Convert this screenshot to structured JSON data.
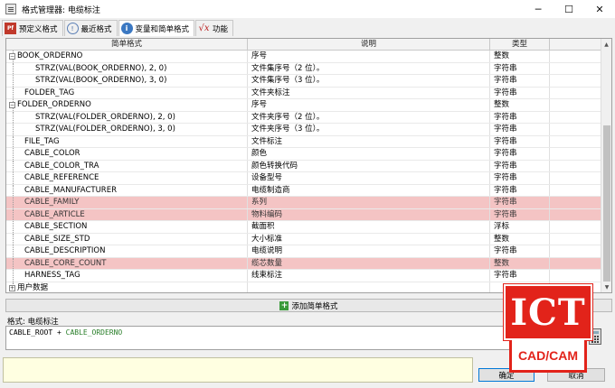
{
  "window": {
    "title": "格式管理器: 电缆标注",
    "min": "─",
    "max": "☐",
    "close": "✕"
  },
  "tabs": [
    {
      "label": "预定义格式",
      "icon": "preset-format-icon",
      "glyph": "Pf"
    },
    {
      "label": "最近格式",
      "icon": "clock-icon",
      "glyph": "!"
    },
    {
      "label": "变量和简单格式",
      "icon": "info-icon",
      "glyph": "i"
    },
    {
      "label": "功能",
      "icon": "function-icon",
      "glyph": "√x"
    }
  ],
  "grid": {
    "headers": {
      "name": "简单格式",
      "desc": "说明",
      "type": "类型"
    },
    "rows": [
      {
        "name": "BOOK_ORDERNO",
        "desc": "序号",
        "type": "整数",
        "indent": 0,
        "expander": "−"
      },
      {
        "name": "STRZ(VAL(BOOK_ORDERNO), 2, 0)",
        "desc": "文件集序号（2 位）。",
        "type": "字符串",
        "indent": 2
      },
      {
        "name": "STRZ(VAL(BOOK_ORDERNO), 3, 0)",
        "desc": "文件集序号（3 位）。",
        "type": "字符串",
        "indent": 2
      },
      {
        "name": "FOLDER_TAG",
        "desc": "文件夹标注",
        "type": "字符串",
        "indent": 1
      },
      {
        "name": "FOLDER_ORDERNO",
        "desc": "序号",
        "type": "整数",
        "indent": 0,
        "expander": "−"
      },
      {
        "name": "STRZ(VAL(FOLDER_ORDERNO), 2, 0)",
        "desc": "文件夹序号（2 位）。",
        "type": "字符串",
        "indent": 2
      },
      {
        "name": "STRZ(VAL(FOLDER_ORDERNO), 3, 0)",
        "desc": "文件夹序号（3 位）。",
        "type": "字符串",
        "indent": 2
      },
      {
        "name": "FILE_TAG",
        "desc": "文件标注",
        "type": "字符串",
        "indent": 1
      },
      {
        "name": "CABLE_COLOR",
        "desc": "颜色",
        "type": "字符串",
        "indent": 1
      },
      {
        "name": "CABLE_COLOR_TRA",
        "desc": "颜色转换代码",
        "type": "字符串",
        "indent": 1
      },
      {
        "name": "CABLE_REFERENCE",
        "desc": "设备型号",
        "type": "字符串",
        "indent": 1
      },
      {
        "name": "CABLE_MANUFACTURER",
        "desc": "电缆制造商",
        "type": "字符串",
        "indent": 1
      },
      {
        "name": "CABLE_FAMILY",
        "desc": "系列",
        "type": "字符串",
        "indent": 1,
        "highlight": true
      },
      {
        "name": "CABLE_ARTICLE",
        "desc": "物料编码",
        "type": "字符串",
        "indent": 1,
        "highlight": true
      },
      {
        "name": "CABLE_SECTION",
        "desc": "截面积",
        "type": "浮标",
        "indent": 1
      },
      {
        "name": "CABLE_SIZE_STD",
        "desc": "大小标准",
        "type": "整数",
        "indent": 1
      },
      {
        "name": "CABLE_DESCRIPTION",
        "desc": "电缆说明",
        "type": "字符串",
        "indent": 1
      },
      {
        "name": "CABLE_CORE_COUNT",
        "desc": "缆芯数量",
        "type": "整数",
        "indent": 1,
        "highlight": true
      },
      {
        "name": "HARNESS_TAG",
        "desc": "线束标注",
        "type": "字符串",
        "indent": 1
      },
      {
        "name": "用户数据",
        "desc": "",
        "type": "",
        "indent": 0,
        "expander": "+"
      }
    ]
  },
  "add_button": {
    "label": "添加简单格式"
  },
  "format": {
    "label": "格式: 电缆标注",
    "expr_left": "CABLE_ROOT + ",
    "expr_var": "CABLE_ORDERNO"
  },
  "buttons": {
    "ok": "确定",
    "cancel": "取消"
  },
  "logo": {
    "top": "ICT",
    "bottom": "CAD/CAM",
    "color": "#e2231a"
  }
}
